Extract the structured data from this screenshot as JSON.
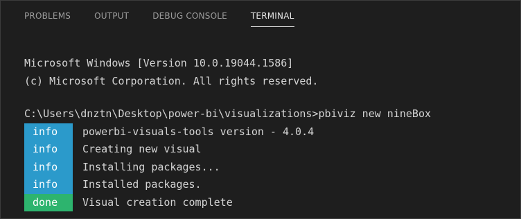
{
  "tabs": [
    {
      "label": "PROBLEMS",
      "active": false
    },
    {
      "label": "OUTPUT",
      "active": false
    },
    {
      "label": "DEBUG CONSOLE",
      "active": false
    },
    {
      "label": "TERMINAL",
      "active": true
    }
  ],
  "terminal": {
    "header_lines": [
      "Microsoft Windows [Version 10.0.19044.1586]",
      "(c) Microsoft Corporation. All rights reserved."
    ],
    "prompt_line": "C:\\Users\\dnztn\\Desktop\\power-bi\\visualizations>pbiviz new nineBox",
    "log_entries": [
      {
        "level": "info",
        "message": "powerbi-visuals-tools version - 4.0.4"
      },
      {
        "level": "info",
        "message": "Creating new visual"
      },
      {
        "level": "info",
        "message": "Installing packages..."
      },
      {
        "level": "info",
        "message": "Installed packages."
      },
      {
        "level": "done",
        "message": "Visual creation complete"
      }
    ]
  },
  "colors": {
    "background": "#1e1e1e",
    "info_badge": "#2b9acb",
    "done_badge": "#2db46e",
    "text": "#d4d4d4"
  }
}
